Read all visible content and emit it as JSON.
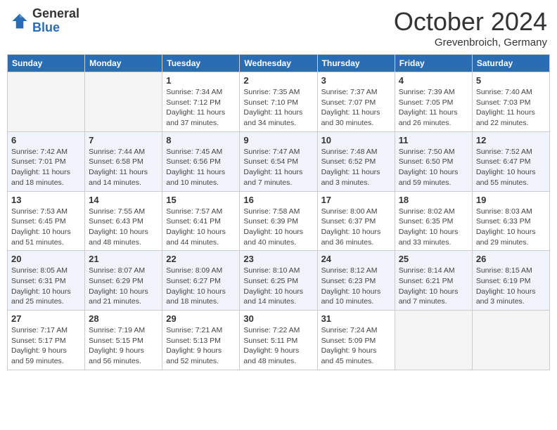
{
  "header": {
    "logo_general": "General",
    "logo_blue": "Blue",
    "month_title": "October 2024",
    "subtitle": "Grevenbroich, Germany"
  },
  "days_of_week": [
    "Sunday",
    "Monday",
    "Tuesday",
    "Wednesday",
    "Thursday",
    "Friday",
    "Saturday"
  ],
  "weeks": [
    [
      {
        "day": "",
        "info": ""
      },
      {
        "day": "",
        "info": ""
      },
      {
        "day": "1",
        "info": "Sunrise: 7:34 AM\nSunset: 7:12 PM\nDaylight: 11 hours\nand 37 minutes."
      },
      {
        "day": "2",
        "info": "Sunrise: 7:35 AM\nSunset: 7:10 PM\nDaylight: 11 hours\nand 34 minutes."
      },
      {
        "day": "3",
        "info": "Sunrise: 7:37 AM\nSunset: 7:07 PM\nDaylight: 11 hours\nand 30 minutes."
      },
      {
        "day": "4",
        "info": "Sunrise: 7:39 AM\nSunset: 7:05 PM\nDaylight: 11 hours\nand 26 minutes."
      },
      {
        "day": "5",
        "info": "Sunrise: 7:40 AM\nSunset: 7:03 PM\nDaylight: 11 hours\nand 22 minutes."
      }
    ],
    [
      {
        "day": "6",
        "info": "Sunrise: 7:42 AM\nSunset: 7:01 PM\nDaylight: 11 hours\nand 18 minutes."
      },
      {
        "day": "7",
        "info": "Sunrise: 7:44 AM\nSunset: 6:58 PM\nDaylight: 11 hours\nand 14 minutes."
      },
      {
        "day": "8",
        "info": "Sunrise: 7:45 AM\nSunset: 6:56 PM\nDaylight: 11 hours\nand 10 minutes."
      },
      {
        "day": "9",
        "info": "Sunrise: 7:47 AM\nSunset: 6:54 PM\nDaylight: 11 hours\nand 7 minutes."
      },
      {
        "day": "10",
        "info": "Sunrise: 7:48 AM\nSunset: 6:52 PM\nDaylight: 11 hours\nand 3 minutes."
      },
      {
        "day": "11",
        "info": "Sunrise: 7:50 AM\nSunset: 6:50 PM\nDaylight: 10 hours\nand 59 minutes."
      },
      {
        "day": "12",
        "info": "Sunrise: 7:52 AM\nSunset: 6:47 PM\nDaylight: 10 hours\nand 55 minutes."
      }
    ],
    [
      {
        "day": "13",
        "info": "Sunrise: 7:53 AM\nSunset: 6:45 PM\nDaylight: 10 hours\nand 51 minutes."
      },
      {
        "day": "14",
        "info": "Sunrise: 7:55 AM\nSunset: 6:43 PM\nDaylight: 10 hours\nand 48 minutes."
      },
      {
        "day": "15",
        "info": "Sunrise: 7:57 AM\nSunset: 6:41 PM\nDaylight: 10 hours\nand 44 minutes."
      },
      {
        "day": "16",
        "info": "Sunrise: 7:58 AM\nSunset: 6:39 PM\nDaylight: 10 hours\nand 40 minutes."
      },
      {
        "day": "17",
        "info": "Sunrise: 8:00 AM\nSunset: 6:37 PM\nDaylight: 10 hours\nand 36 minutes."
      },
      {
        "day": "18",
        "info": "Sunrise: 8:02 AM\nSunset: 6:35 PM\nDaylight: 10 hours\nand 33 minutes."
      },
      {
        "day": "19",
        "info": "Sunrise: 8:03 AM\nSunset: 6:33 PM\nDaylight: 10 hours\nand 29 minutes."
      }
    ],
    [
      {
        "day": "20",
        "info": "Sunrise: 8:05 AM\nSunset: 6:31 PM\nDaylight: 10 hours\nand 25 minutes."
      },
      {
        "day": "21",
        "info": "Sunrise: 8:07 AM\nSunset: 6:29 PM\nDaylight: 10 hours\nand 21 minutes."
      },
      {
        "day": "22",
        "info": "Sunrise: 8:09 AM\nSunset: 6:27 PM\nDaylight: 10 hours\nand 18 minutes."
      },
      {
        "day": "23",
        "info": "Sunrise: 8:10 AM\nSunset: 6:25 PM\nDaylight: 10 hours\nand 14 minutes."
      },
      {
        "day": "24",
        "info": "Sunrise: 8:12 AM\nSunset: 6:23 PM\nDaylight: 10 hours\nand 10 minutes."
      },
      {
        "day": "25",
        "info": "Sunrise: 8:14 AM\nSunset: 6:21 PM\nDaylight: 10 hours\nand 7 minutes."
      },
      {
        "day": "26",
        "info": "Sunrise: 8:15 AM\nSunset: 6:19 PM\nDaylight: 10 hours\nand 3 minutes."
      }
    ],
    [
      {
        "day": "27",
        "info": "Sunrise: 7:17 AM\nSunset: 5:17 PM\nDaylight: 9 hours\nand 59 minutes."
      },
      {
        "day": "28",
        "info": "Sunrise: 7:19 AM\nSunset: 5:15 PM\nDaylight: 9 hours\nand 56 minutes."
      },
      {
        "day": "29",
        "info": "Sunrise: 7:21 AM\nSunset: 5:13 PM\nDaylight: 9 hours\nand 52 minutes."
      },
      {
        "day": "30",
        "info": "Sunrise: 7:22 AM\nSunset: 5:11 PM\nDaylight: 9 hours\nand 48 minutes."
      },
      {
        "day": "31",
        "info": "Sunrise: 7:24 AM\nSunset: 5:09 PM\nDaylight: 9 hours\nand 45 minutes."
      },
      {
        "day": "",
        "info": ""
      },
      {
        "day": "",
        "info": ""
      }
    ]
  ]
}
